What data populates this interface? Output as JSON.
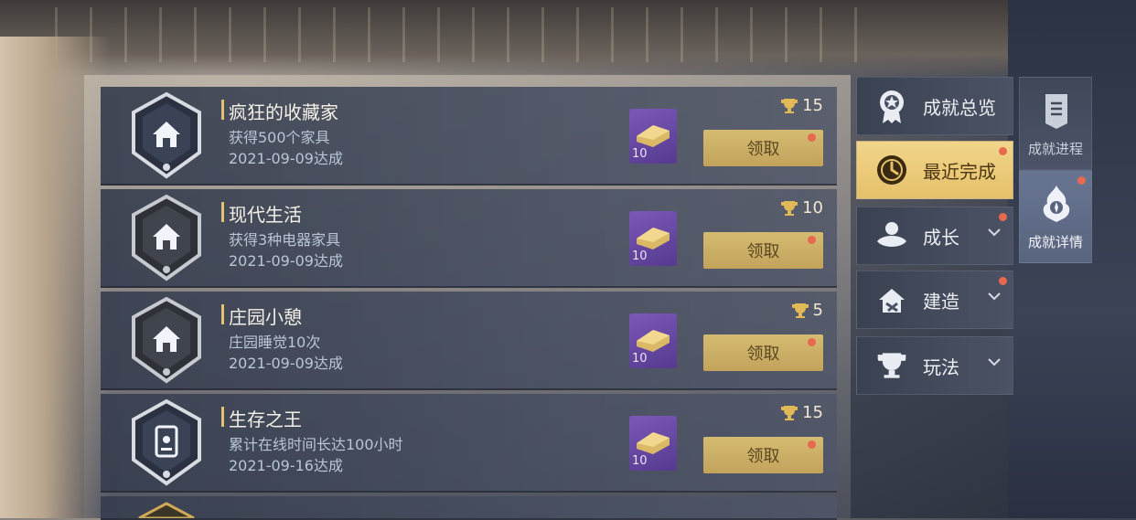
{
  "achievements": [
    {
      "title": "疯狂的收藏家",
      "desc": "获得500个家具",
      "date": "2021-09-09达成",
      "points": "15",
      "chest_count": "10",
      "claim_label": "领取",
      "badge_icon": "house-icon"
    },
    {
      "title": "现代生活",
      "desc": "获得3种电器家具",
      "date": "2021-09-09达成",
      "points": "10",
      "chest_count": "10",
      "claim_label": "领取",
      "badge_icon": "house-icon"
    },
    {
      "title": "庄园小憩",
      "desc": "庄园睡觉10次",
      "date": "2021-09-09达成",
      "points": "5",
      "chest_count": "10",
      "claim_label": "领取",
      "badge_icon": "house-icon"
    },
    {
      "title": "生存之王",
      "desc": "累计在线时间长达100小时",
      "date": "2021-09-16达成",
      "points": "15",
      "chest_count": "10",
      "claim_label": "领取",
      "badge_icon": "phone-icon"
    }
  ],
  "tabs": [
    {
      "label": "成就总览",
      "icon": "medal-icon",
      "active": false,
      "dot": false,
      "chevron": false
    },
    {
      "label": "最近完成",
      "icon": "clock-icon",
      "active": true,
      "dot": true,
      "chevron": false
    },
    {
      "label": "成长",
      "icon": "growth-icon",
      "active": false,
      "dot": true,
      "chevron": true
    },
    {
      "label": "建造",
      "icon": "build-icon",
      "active": false,
      "dot": true,
      "chevron": true
    },
    {
      "label": "玩法",
      "icon": "trophy-icon",
      "active": false,
      "dot": false,
      "chevron": true
    }
  ],
  "side_tabs": [
    {
      "label": "成就进程",
      "icon": "scroll-icon",
      "active": false,
      "dot": false
    },
    {
      "label": "成就详情",
      "icon": "flame-emblem-icon",
      "active": true,
      "dot": true
    }
  ],
  "colors": {
    "accent_gold": "#e6c06a",
    "red_dot": "#e86a4e"
  }
}
